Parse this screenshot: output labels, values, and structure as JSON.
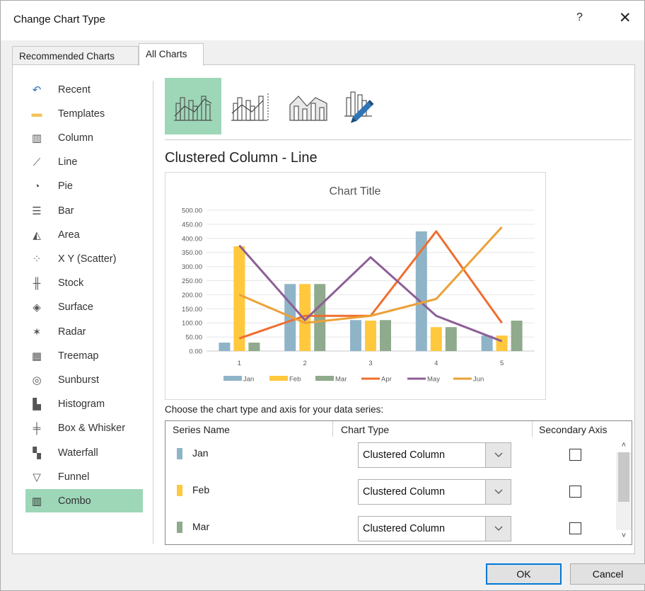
{
  "dialog": {
    "title": "Change Chart Type",
    "help_label": "?",
    "close_label": "✕"
  },
  "tabs": [
    {
      "label": "Recommended Charts",
      "active": false
    },
    {
      "label": "All Charts",
      "active": true
    }
  ],
  "sidebar": {
    "items": [
      {
        "label": "Recent",
        "icon": "recent-icon"
      },
      {
        "label": "Templates",
        "icon": "folder-icon"
      },
      {
        "label": "Column",
        "icon": "column-chart-icon"
      },
      {
        "label": "Line",
        "icon": "line-chart-icon"
      },
      {
        "label": "Pie",
        "icon": "pie-chart-icon"
      },
      {
        "label": "Bar",
        "icon": "bar-chart-icon"
      },
      {
        "label": "Area",
        "icon": "area-chart-icon"
      },
      {
        "label": "X Y (Scatter)",
        "icon": "scatter-chart-icon"
      },
      {
        "label": "Stock",
        "icon": "stock-chart-icon"
      },
      {
        "label": "Surface",
        "icon": "surface-chart-icon"
      },
      {
        "label": "Radar",
        "icon": "radar-chart-icon"
      },
      {
        "label": "Treemap",
        "icon": "treemap-chart-icon"
      },
      {
        "label": "Sunburst",
        "icon": "sunburst-chart-icon"
      },
      {
        "label": "Histogram",
        "icon": "histogram-chart-icon"
      },
      {
        "label": "Box & Whisker",
        "icon": "box-whisker-chart-icon"
      },
      {
        "label": "Waterfall",
        "icon": "waterfall-chart-icon"
      },
      {
        "label": "Funnel",
        "icon": "funnel-chart-icon"
      },
      {
        "label": "Combo",
        "icon": "combo-chart-icon",
        "selected": true
      }
    ]
  },
  "subtypes": [
    {
      "name": "clustered-column-line",
      "selected": true
    },
    {
      "name": "clustered-column-line-secondary-axis",
      "selected": false
    },
    {
      "name": "stacked-area-clustered-column",
      "selected": false
    },
    {
      "name": "custom-combination",
      "selected": false
    }
  ],
  "subtype_title": "Clustered Column - Line",
  "choose_label": "Choose the chart type and axis for your data series:",
  "table": {
    "headers": [
      "Series Name",
      "Chart Type",
      "Secondary Axis"
    ],
    "rows": [
      {
        "name": "Jan",
        "color": "#8fb4c8",
        "chart_type": "Clustered Column",
        "secondary": false
      },
      {
        "name": "Feb",
        "color": "#ffc83d",
        "chart_type": "Clustered Column",
        "secondary": false
      },
      {
        "name": "Mar",
        "color": "#8faa8c",
        "chart_type": "Clustered Column",
        "secondary": false
      }
    ],
    "scroll_up": "˄",
    "scroll_down": "˅"
  },
  "buttons": {
    "ok": "OK",
    "cancel": "Cancel"
  },
  "colors": {
    "selected_bg": "#9ed7b8",
    "ok_border": "#0078d7"
  },
  "chart_data": {
    "type": "bar",
    "title": "Chart Title",
    "categories": [
      "1",
      "2",
      "3",
      "4",
      "5"
    ],
    "y_ticks": [
      "500.00",
      "450.00",
      "400.00",
      "350.00",
      "300.00",
      "250.00",
      "200.00",
      "150.00",
      "100.00",
      "50.00",
      "0.00"
    ],
    "ylim": [
      0,
      500
    ],
    "grid": true,
    "legend_position": "bottom",
    "column_series": [
      {
        "name": "Jan",
        "color": "#8fb4c8",
        "values": [
          30,
          238,
          110,
          425,
          55
        ]
      },
      {
        "name": "Feb",
        "color": "#ffc83d",
        "values": [
          372,
          238,
          108,
          85,
          55
        ]
      },
      {
        "name": "Mar",
        "color": "#8faa8c",
        "values": [
          30,
          238,
          110,
          85,
          108
        ]
      }
    ],
    "line_series": [
      {
        "name": "Apr",
        "color": "#ef6e2f",
        "values": [
          45,
          125,
          125,
          425,
          100
        ]
      },
      {
        "name": "May",
        "color": "#8d5f96",
        "values": [
          375,
          110,
          333,
          125,
          35
        ]
      },
      {
        "name": "Jun",
        "color": "#eba137",
        "values": [
          200,
          100,
          125,
          185,
          440
        ]
      }
    ]
  }
}
